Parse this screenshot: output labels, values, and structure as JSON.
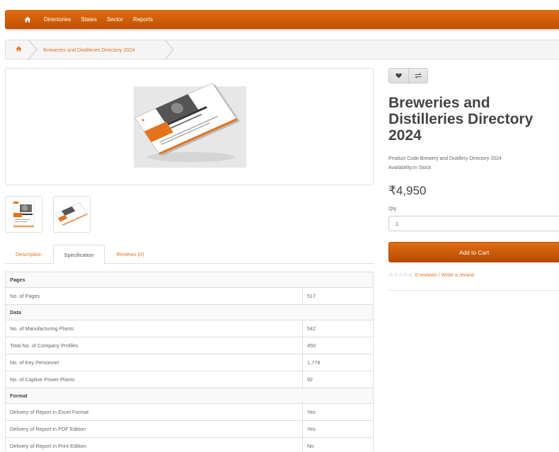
{
  "nav": {
    "items": [
      "Directories",
      "States",
      "Sector",
      "Reports"
    ]
  },
  "breadcrumb": {
    "current": "Breweries and Distilleries Directory 2024"
  },
  "product": {
    "title": "Breweries and Distilleries Directory 2024",
    "code_label": "Product Code:",
    "code": "Brewery and Distillery Directory 2024",
    "availability_label": "Availability:",
    "availability": "In Stock",
    "price": "₹4,950",
    "qty_label": "Qty",
    "qty_value": "1",
    "add_to_cart": "Add to Cart",
    "reviews_link": "0 reviews",
    "review_separator": "/",
    "write_review_link": "Write a review",
    "rating_stars": 0
  },
  "tabs": [
    "Description",
    "Specification",
    "Reviews (0)"
  ],
  "active_tab": "Specification",
  "specification": {
    "groups": [
      {
        "name": "Pages",
        "rows": [
          {
            "label": "No. of Pages",
            "value": "517"
          }
        ]
      },
      {
        "name": "Data",
        "rows": [
          {
            "label": "No. of Manufacturing Plants",
            "value": "542"
          },
          {
            "label": "Total No. of Company Profiles",
            "value": "450"
          },
          {
            "label": "No. of Key Personnel",
            "value": "1,778"
          },
          {
            "label": "No. of Captive Power Plants",
            "value": "92"
          }
        ]
      },
      {
        "name": "Format",
        "rows": [
          {
            "label": "Delivery of Report in Excel Format",
            "value": "Yes"
          },
          {
            "label": "Delivery of Report in PDF Edition",
            "value": "Yes"
          },
          {
            "label": "Delivery of Report in Print Edition",
            "value": "No"
          }
        ]
      }
    ]
  },
  "icons": {
    "nav_home": "home-icon",
    "breadcrumb_home": "home-icon",
    "wishlist": "heart-icon",
    "compare": "compare-arrows-icon",
    "star": "star-outline-icon"
  },
  "colors": {
    "accent": "#e4731c",
    "navbar": "#d35f0a",
    "button": "#cc5c0a"
  }
}
